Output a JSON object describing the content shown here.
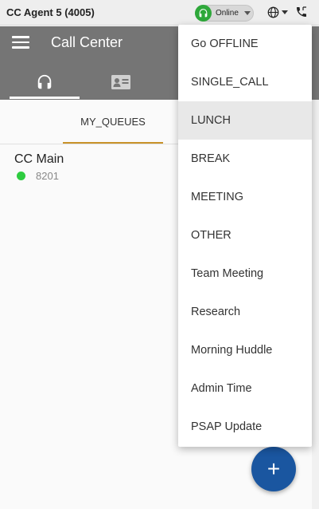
{
  "topbar": {
    "agent_name": "CC Agent 5 (4005)",
    "status_label": "Online",
    "status_color": "#2ea83a"
  },
  "appbar": {
    "title": "Call Center",
    "background": "#757575",
    "tabs": [
      {
        "icon": "headset-icon",
        "active": true
      },
      {
        "icon": "contact-card-icon",
        "active": false
      }
    ]
  },
  "queues": {
    "tab_label": "MY_QUEUES",
    "items": [
      {
        "name": "CC Main",
        "extension": "8201",
        "status_color": "#2ecc40"
      }
    ]
  },
  "status_menu": {
    "items": [
      {
        "label": "Go OFFLINE"
      },
      {
        "label": "SINGLE_CALL"
      },
      {
        "label": "LUNCH",
        "highlighted": true
      },
      {
        "label": "BREAK"
      },
      {
        "label": "MEETING"
      },
      {
        "label": "OTHER"
      },
      {
        "label": "Team Meeting"
      },
      {
        "label": "Research"
      },
      {
        "label": "Morning Huddle"
      },
      {
        "label": "Admin Time"
      },
      {
        "label": "PSAP Update"
      }
    ]
  },
  "fab": {
    "label": "+",
    "color": "#1a56a0"
  }
}
